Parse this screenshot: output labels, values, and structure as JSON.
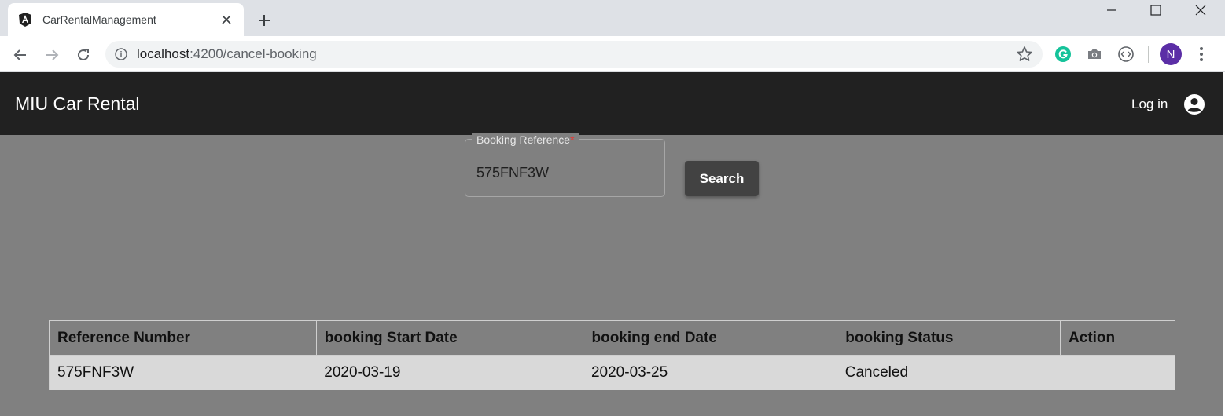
{
  "browser": {
    "tab_title": "CarRentalManagement",
    "url_host": "localhost",
    "url_path": ":4200/cancel-booking",
    "avatar_letter": "N"
  },
  "header": {
    "brand": "MIU Car Rental",
    "login_label": "Log in"
  },
  "search": {
    "label": "Booking Reference",
    "required_mark": "*",
    "value": "575FNF3W",
    "button_label": "Search"
  },
  "table": {
    "headers": [
      "Reference Number",
      "booking Start Date",
      "booking end Date",
      "booking Status",
      "Action"
    ],
    "rows": [
      [
        "575FNF3W",
        "2020-03-19",
        "2020-03-25",
        "Canceled",
        ""
      ]
    ]
  },
  "icons": {
    "tab_favicon": "angular-icon",
    "account": "account-circle-icon"
  }
}
